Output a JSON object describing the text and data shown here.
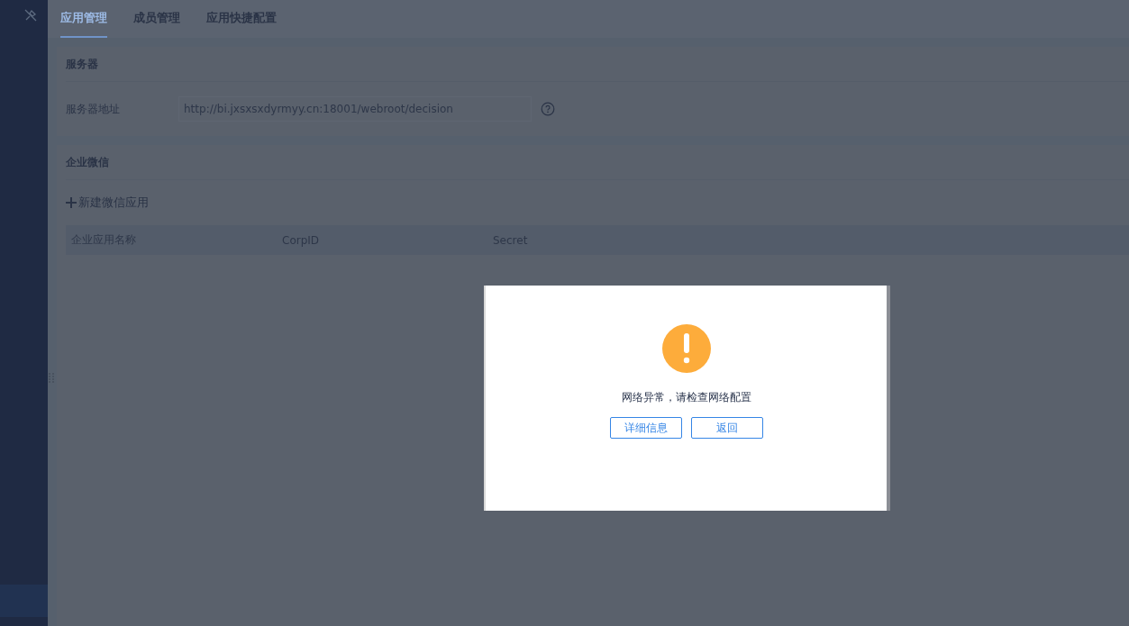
{
  "sidebar": {
    "items": [
      {
        "selected": true
      }
    ]
  },
  "tabs": [
    {
      "label": "应用管理",
      "selected": true
    },
    {
      "label": "成员管理",
      "selected": false
    },
    {
      "label": "应用快捷配置",
      "selected": false
    }
  ],
  "server_panel": {
    "title": "服务器",
    "field_label": "服务器地址",
    "field_value": "http://bi.jxsxsxdyrmyy.cn:18001/webroot/decision"
  },
  "wechat_panel": {
    "title": "企业微信",
    "add_button": "新建微信应用",
    "table": {
      "columns": [
        "企业应用名称",
        "CorpID",
        "Secret"
      ]
    }
  },
  "dialog": {
    "message": "网络异常，请检查网络配置",
    "buttons": [
      "详细信息",
      "返回"
    ]
  }
}
